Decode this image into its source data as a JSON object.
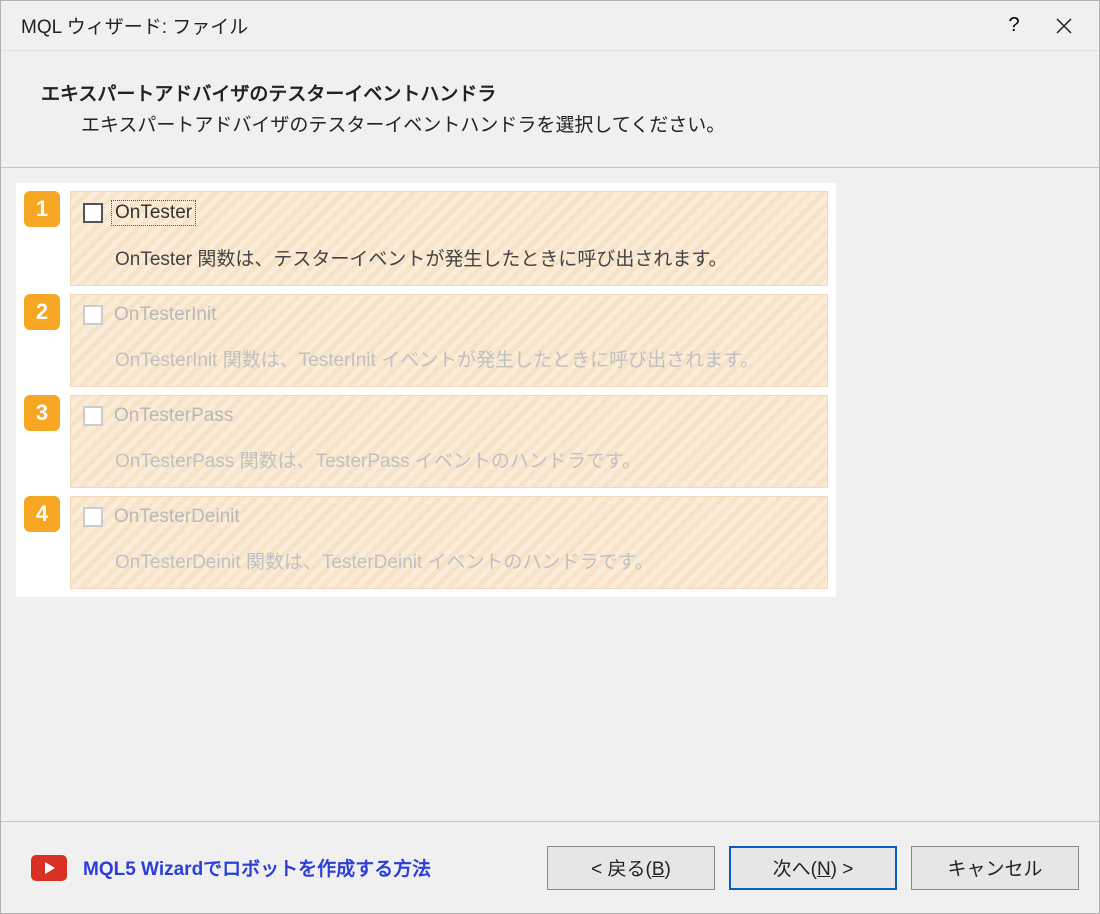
{
  "window": {
    "title": "MQL ウィザード: ファイル",
    "help_symbol": "?"
  },
  "header": {
    "title": "エキスパートアドバイザのテスターイベントハンドラ",
    "subtitle": "エキスパートアドバイザのテスターイベントハンドラを選択してください。"
  },
  "options": [
    {
      "num": "1",
      "label": "OnTester",
      "desc": "OnTester 関数は、テスターイベントが発生したときに呼び出されます。",
      "state": "active"
    },
    {
      "num": "2",
      "label": "OnTesterInit",
      "desc": "OnTesterInit 関数は、TesterInit イベントが発生したときに呼び出されます。",
      "state": "disabled"
    },
    {
      "num": "3",
      "label": "OnTesterPass",
      "desc": "OnTesterPass 関数は、TesterPass イベントのハンドラです。",
      "state": "disabled"
    },
    {
      "num": "4",
      "label": "OnTesterDeinit",
      "desc": "OnTesterDeinit 関数は、TesterDeinit イベントのハンドラです。",
      "state": "disabled"
    }
  ],
  "footer": {
    "help_link": "MQL5 Wizardでロボットを作成する方法",
    "back": {
      "pre": "< 戻る(",
      "key": "B",
      "post": ")"
    },
    "next": {
      "pre": "次へ(",
      "key": "N",
      "post": ") >"
    },
    "cancel": "キャンセル"
  }
}
